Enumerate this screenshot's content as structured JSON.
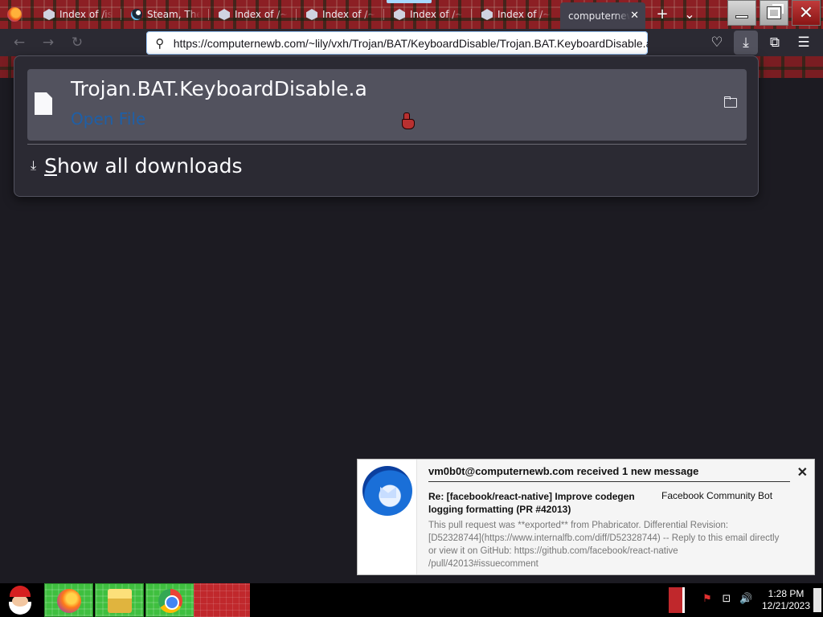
{
  "browser": {
    "tabs": [
      {
        "label": "Index of /iso",
        "icon": "site-icon"
      },
      {
        "label": "Steam, The Ultimate",
        "icon": "steam-icon"
      },
      {
        "label": "Index of /~lily",
        "icon": "site-icon"
      },
      {
        "label": "Index of /~lily",
        "icon": "site-icon"
      },
      {
        "label": "Index of /~lily",
        "icon": "site-icon"
      },
      {
        "label": "Index of /~lily",
        "icon": "site-icon"
      },
      {
        "label": "computernewb",
        "icon": "none"
      }
    ],
    "close_glyph": "✕",
    "new_tab_glyph": "+",
    "list_tabs_glyph": "⌄",
    "url": "https://computernewb.com/~lily/vxh/Trojan/BAT/KeyboardDisable/Trojan.BAT.KeyboardDisable.a",
    "nav": {
      "back": "←",
      "forward": "→",
      "reload": "↻",
      "search": "⚲"
    },
    "toolbar": {
      "pocket": "♡",
      "downloads": "⤓",
      "extensions": "⧉",
      "menu": "☰"
    }
  },
  "downloads_panel": {
    "file_name": "Trojan.BAT.KeyboardDisable.a",
    "status": "Open File",
    "show_all_first": "S",
    "show_all_rest": "how all downloads",
    "download_glyph": "⤓"
  },
  "notification": {
    "title": "vm0b0t@computernewb.com received 1 new message",
    "close_glyph": "✕",
    "subject": "Re: [facebook/react-native] Improve codegen logging formatting (PR #42013)",
    "from": "Facebook Community Bot",
    "body": "This pull request was **exported** from Phabricator. Differential Revision: [D52328744](https://www.internalfb.com/diff/D52328744) -- Reply to this email directly or view it on GitHub: https://github.com/facebook/react-native /pull/42013#issuecomment"
  },
  "taskbar": {
    "time": "1:28 PM",
    "date": "12/21/2023",
    "tray": {
      "network": "⊡",
      "volume": "🔊",
      "warning": "⚑"
    }
  },
  "colors": {
    "link_blue": "#1f5fa6",
    "panel_bg": "#2b2a33",
    "taskbar_green": "#3fbf3f"
  }
}
